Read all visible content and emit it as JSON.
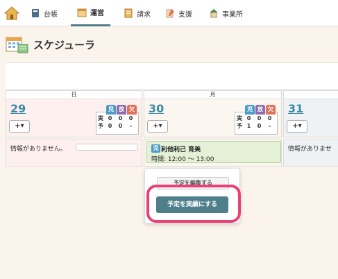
{
  "nav": {
    "items": [
      {
        "label": "台帳",
        "icon": "book-icon"
      },
      {
        "label": "運営",
        "icon": "calendar-icon"
      },
      {
        "label": "請求",
        "icon": "invoice-icon"
      },
      {
        "label": "支援",
        "icon": "pencil-icon"
      },
      {
        "label": "事業所",
        "icon": "building-icon"
      }
    ],
    "active": "運営"
  },
  "page": {
    "title": "スケジューラ"
  },
  "counter_headers": {
    "child": "児",
    "after": "放",
    "absent": "欠"
  },
  "counter_rows": {
    "actual": "実",
    "planned": "予"
  },
  "days": [
    {
      "weekday": "日",
      "date": "29",
      "add_label": "+▾",
      "actual": [
        "0",
        "0",
        "0"
      ],
      "planned": [
        "0",
        "0",
        "-"
      ],
      "info": "情報がありません。"
    },
    {
      "weekday": "月",
      "date": "30",
      "add_label": "+▾",
      "actual": [
        "0",
        "0",
        "0"
      ],
      "planned": [
        "1",
        "0",
        "-"
      ]
    },
    {
      "weekday": "",
      "date": "31",
      "add_label": "+▾",
      "info": "情報がありませ"
    }
  ],
  "event": {
    "badge": "児",
    "name": "利他利己 育美",
    "time": "時間: 12:00 〜 13:00"
  },
  "popup": {
    "edit_label": "予定を編集する",
    "make_actual_label": "予定を実績にする"
  },
  "colors": {
    "accent": "#4f7f8b",
    "highlight": "#ee3f74",
    "child_badge": "#4a9bc8",
    "after_badge": "#8c6bb1",
    "absent_badge": "#e0705a"
  }
}
